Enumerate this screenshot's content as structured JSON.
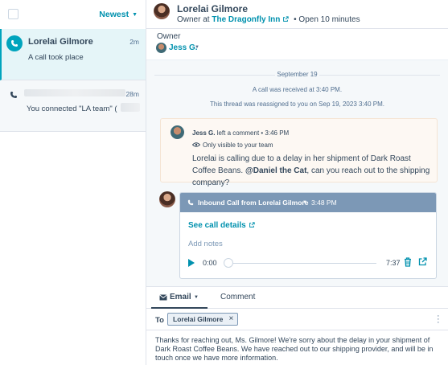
{
  "inbox_list": {
    "sort_label": "Newest",
    "conversations": [
      {
        "name": "Lorelai Gilmore",
        "time": "2m",
        "preview": "A call took place"
      },
      {
        "name": "",
        "time": "28m",
        "preview": "You connected \"LA team\" ("
      }
    ]
  },
  "header": {
    "contact_name": "Lorelai Gilmore",
    "owner_prefix": "Owner at",
    "company": "The Dragonfly Inn",
    "status": "• Open 10 minutes"
  },
  "owner": {
    "label": "Owner",
    "name": "Jess G."
  },
  "thread": {
    "date": "September 19",
    "events": [
      "A call was received at 3:40 PM.",
      "This thread was reassigned to you on Sep 19, 2023 3:40 PM."
    ],
    "comment": {
      "author": "Jess G.",
      "action": "left a comment",
      "time": "• 3:46 PM",
      "visibility": "Only visible to your team",
      "body_pre": "Lorelai is calling due to a delay in her shipment of Dark Roast Coffee Beans. ",
      "mention": "@Daniel the Cat",
      "body_post": ", can you reach out to the shipping company?"
    },
    "call": {
      "title": "Inbound Call from Lorelai Gilmore",
      "time": "3:48 PM",
      "details_link": "See call details",
      "notes_placeholder": "Add notes",
      "start_time": "0:00",
      "duration": "7:37",
      "progress": 0
    }
  },
  "composer": {
    "tabs": [
      "Email",
      "Comment"
    ],
    "to_label": "To",
    "recipient": "Lorelai Gilmore",
    "body": "Thanks for reaching out, Ms. Gilmore! We're sorry about the delay in your shipment of Dark Roast Coffee Beans. We have reached out to our shipping provider, and will be in touch once we have more information."
  },
  "colors": {
    "accent": "#0091ae",
    "call_header": "#7c98b6",
    "active_row": "#e5f5f8",
    "comment_bg": "#fdf8f3"
  }
}
